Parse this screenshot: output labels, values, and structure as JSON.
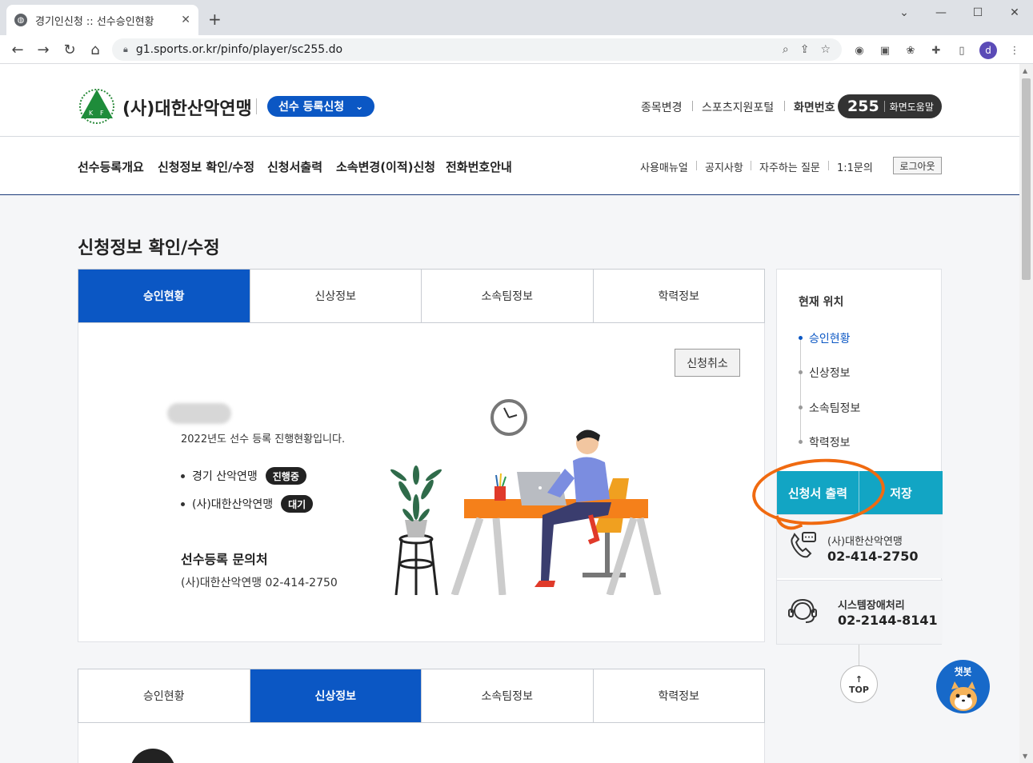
{
  "browser": {
    "tab_title": "경기인신청 :: 선수승인현황",
    "tab_close": "✕",
    "new_tab": "+",
    "url": "g1.sports.or.kr/pinfo/player/sc255.do",
    "avatar_letter": "d"
  },
  "header": {
    "org_name": "(사)대한산악연맹",
    "reg_badge": "선수 등록신청",
    "util_links": [
      "종목변경",
      "스포츠지원포털",
      "화면번호"
    ],
    "screen_number": "255",
    "screen_help": "화면도움말",
    "gnb": [
      "선수등록개요",
      "신청정보 확인/수정",
      "신청서출력",
      "소속변경(이적)신청",
      "전화번호안내"
    ],
    "sub_links": [
      "사용매뉴얼",
      "공지사항",
      "자주하는 질문",
      "1:1문의"
    ],
    "logout": "로그아웃"
  },
  "page_title": "신청정보 확인/수정",
  "tabs": [
    "승인현황",
    "신상정보",
    "소속팀정보",
    "학력정보"
  ],
  "approval": {
    "cancel_button": "신청취소",
    "intro": "2022년도 선수 등록 진행현황입니다.",
    "statuses": [
      {
        "org": "경기 산악연맹",
        "badge": "진행중"
      },
      {
        "org": "(사)대한산악연맹",
        "badge": "대기"
      }
    ],
    "contact_title": "선수등록 문의처",
    "contact_line": "(사)대한산악연맹 02-414-2750"
  },
  "side": {
    "title": "현재 위치",
    "items": [
      "승인현황",
      "신상정보",
      "소속팀정보",
      "학력정보"
    ],
    "print_button": "신청서 출력",
    "save_button": "저장",
    "org_contact_label": "(사)대한산악연맹",
    "org_contact_phone": "02-414-2750",
    "sys_contact_label": "시스템장애처리",
    "sys_contact_phone": "02-2144-8141",
    "top_button": "TOP"
  },
  "chatbot_label": "챗봇",
  "colors": {
    "primary": "#0b57c4",
    "accent": "#12a5c4",
    "annotation": "#f06a10"
  }
}
